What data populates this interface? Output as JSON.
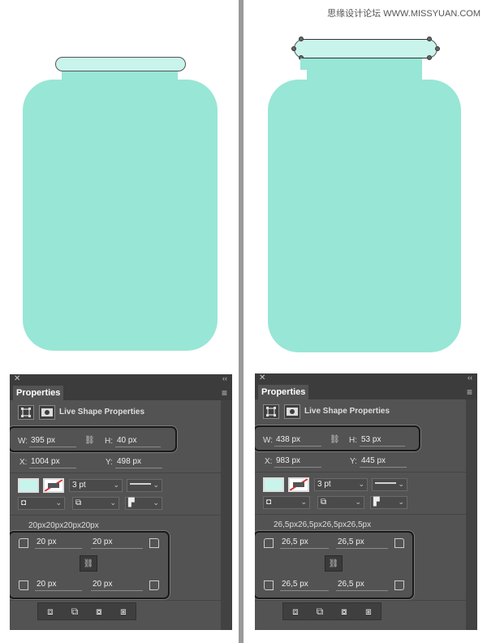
{
  "watermark": "思缘设计论坛 WWW.MISSYUAN.COM",
  "colors": {
    "jar_body": "#98e6d6",
    "lid": "#c9f4eb",
    "panel_bg": "#535353"
  },
  "panels": [
    {
      "tab_label": "Properties",
      "section_label": "Live Shape Properties",
      "w_label": "W:",
      "w_value": "395 px",
      "h_label": "H:",
      "h_value": "40 px",
      "x_label": "X:",
      "x_value": "1004 px",
      "y_label": "Y:",
      "y_value": "498 px",
      "stroke_size": "3 pt",
      "radii_summary": "20px20px20px20px",
      "tl": "20 px",
      "tr": "20 px",
      "bl": "20 px",
      "br": "20 px",
      "fill_color": "#c9f4eb"
    },
    {
      "tab_label": "Properties",
      "section_label": "Live Shape Properties",
      "w_label": "W:",
      "w_value": "438 px",
      "h_label": "H:",
      "h_value": "53 px",
      "x_label": "X:",
      "x_value": "983 px",
      "y_label": "Y:",
      "y_value": "445 px",
      "stroke_size": "3 pt",
      "radii_summary": "26,5px26,5px26,5px26,5px",
      "tl": "26,5 px",
      "tr": "26,5 px",
      "bl": "26,5 px",
      "br": "26,5 px",
      "fill_color": "#c9f4eb"
    }
  ],
  "icons": {
    "close": "close-icon",
    "collapse": "collapse-icon",
    "menu": "panel-menu-icon",
    "link": "link-icon",
    "shape": "live-shape-icon",
    "mask": "mask-icon"
  }
}
